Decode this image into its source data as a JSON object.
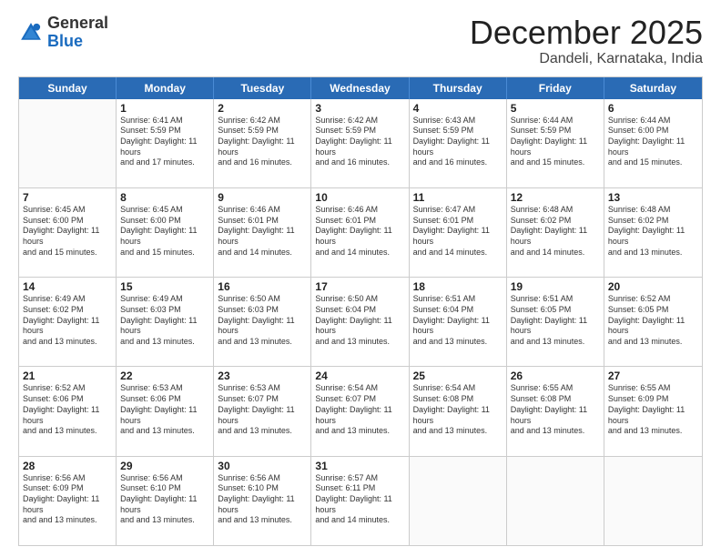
{
  "logo": {
    "general": "General",
    "blue": "Blue"
  },
  "header": {
    "month": "December 2025",
    "location": "Dandeli, Karnataka, India"
  },
  "weekdays": [
    "Sunday",
    "Monday",
    "Tuesday",
    "Wednesday",
    "Thursday",
    "Friday",
    "Saturday"
  ],
  "weeks": [
    [
      {
        "day": "",
        "sunrise": "",
        "sunset": "",
        "daylight": "",
        "empty": true
      },
      {
        "day": "1",
        "sunrise": "Sunrise: 6:41 AM",
        "sunset": "Sunset: 5:59 PM",
        "daylight": "Daylight: 11 hours and 17 minutes."
      },
      {
        "day": "2",
        "sunrise": "Sunrise: 6:42 AM",
        "sunset": "Sunset: 5:59 PM",
        "daylight": "Daylight: 11 hours and 16 minutes."
      },
      {
        "day": "3",
        "sunrise": "Sunrise: 6:42 AM",
        "sunset": "Sunset: 5:59 PM",
        "daylight": "Daylight: 11 hours and 16 minutes."
      },
      {
        "day": "4",
        "sunrise": "Sunrise: 6:43 AM",
        "sunset": "Sunset: 5:59 PM",
        "daylight": "Daylight: 11 hours and 16 minutes."
      },
      {
        "day": "5",
        "sunrise": "Sunrise: 6:44 AM",
        "sunset": "Sunset: 5:59 PM",
        "daylight": "Daylight: 11 hours and 15 minutes."
      },
      {
        "day": "6",
        "sunrise": "Sunrise: 6:44 AM",
        "sunset": "Sunset: 6:00 PM",
        "daylight": "Daylight: 11 hours and 15 minutes."
      }
    ],
    [
      {
        "day": "7",
        "sunrise": "Sunrise: 6:45 AM",
        "sunset": "Sunset: 6:00 PM",
        "daylight": "Daylight: 11 hours and 15 minutes."
      },
      {
        "day": "8",
        "sunrise": "Sunrise: 6:45 AM",
        "sunset": "Sunset: 6:00 PM",
        "daylight": "Daylight: 11 hours and 15 minutes."
      },
      {
        "day": "9",
        "sunrise": "Sunrise: 6:46 AM",
        "sunset": "Sunset: 6:01 PM",
        "daylight": "Daylight: 11 hours and 14 minutes."
      },
      {
        "day": "10",
        "sunrise": "Sunrise: 6:46 AM",
        "sunset": "Sunset: 6:01 PM",
        "daylight": "Daylight: 11 hours and 14 minutes."
      },
      {
        "day": "11",
        "sunrise": "Sunrise: 6:47 AM",
        "sunset": "Sunset: 6:01 PM",
        "daylight": "Daylight: 11 hours and 14 minutes."
      },
      {
        "day": "12",
        "sunrise": "Sunrise: 6:48 AM",
        "sunset": "Sunset: 6:02 PM",
        "daylight": "Daylight: 11 hours and 14 minutes."
      },
      {
        "day": "13",
        "sunrise": "Sunrise: 6:48 AM",
        "sunset": "Sunset: 6:02 PM",
        "daylight": "Daylight: 11 hours and 13 minutes."
      }
    ],
    [
      {
        "day": "14",
        "sunrise": "Sunrise: 6:49 AM",
        "sunset": "Sunset: 6:02 PM",
        "daylight": "Daylight: 11 hours and 13 minutes."
      },
      {
        "day": "15",
        "sunrise": "Sunrise: 6:49 AM",
        "sunset": "Sunset: 6:03 PM",
        "daylight": "Daylight: 11 hours and 13 minutes."
      },
      {
        "day": "16",
        "sunrise": "Sunrise: 6:50 AM",
        "sunset": "Sunset: 6:03 PM",
        "daylight": "Daylight: 11 hours and 13 minutes."
      },
      {
        "day": "17",
        "sunrise": "Sunrise: 6:50 AM",
        "sunset": "Sunset: 6:04 PM",
        "daylight": "Daylight: 11 hours and 13 minutes."
      },
      {
        "day": "18",
        "sunrise": "Sunrise: 6:51 AM",
        "sunset": "Sunset: 6:04 PM",
        "daylight": "Daylight: 11 hours and 13 minutes."
      },
      {
        "day": "19",
        "sunrise": "Sunrise: 6:51 AM",
        "sunset": "Sunset: 6:05 PM",
        "daylight": "Daylight: 11 hours and 13 minutes."
      },
      {
        "day": "20",
        "sunrise": "Sunrise: 6:52 AM",
        "sunset": "Sunset: 6:05 PM",
        "daylight": "Daylight: 11 hours and 13 minutes."
      }
    ],
    [
      {
        "day": "21",
        "sunrise": "Sunrise: 6:52 AM",
        "sunset": "Sunset: 6:06 PM",
        "daylight": "Daylight: 11 hours and 13 minutes."
      },
      {
        "day": "22",
        "sunrise": "Sunrise: 6:53 AM",
        "sunset": "Sunset: 6:06 PM",
        "daylight": "Daylight: 11 hours and 13 minutes."
      },
      {
        "day": "23",
        "sunrise": "Sunrise: 6:53 AM",
        "sunset": "Sunset: 6:07 PM",
        "daylight": "Daylight: 11 hours and 13 minutes."
      },
      {
        "day": "24",
        "sunrise": "Sunrise: 6:54 AM",
        "sunset": "Sunset: 6:07 PM",
        "daylight": "Daylight: 11 hours and 13 minutes."
      },
      {
        "day": "25",
        "sunrise": "Sunrise: 6:54 AM",
        "sunset": "Sunset: 6:08 PM",
        "daylight": "Daylight: 11 hours and 13 minutes."
      },
      {
        "day": "26",
        "sunrise": "Sunrise: 6:55 AM",
        "sunset": "Sunset: 6:08 PM",
        "daylight": "Daylight: 11 hours and 13 minutes."
      },
      {
        "day": "27",
        "sunrise": "Sunrise: 6:55 AM",
        "sunset": "Sunset: 6:09 PM",
        "daylight": "Daylight: 11 hours and 13 minutes."
      }
    ],
    [
      {
        "day": "28",
        "sunrise": "Sunrise: 6:56 AM",
        "sunset": "Sunset: 6:09 PM",
        "daylight": "Daylight: 11 hours and 13 minutes."
      },
      {
        "day": "29",
        "sunrise": "Sunrise: 6:56 AM",
        "sunset": "Sunset: 6:10 PM",
        "daylight": "Daylight: 11 hours and 13 minutes."
      },
      {
        "day": "30",
        "sunrise": "Sunrise: 6:56 AM",
        "sunset": "Sunset: 6:10 PM",
        "daylight": "Daylight: 11 hours and 13 minutes."
      },
      {
        "day": "31",
        "sunrise": "Sunrise: 6:57 AM",
        "sunset": "Sunset: 6:11 PM",
        "daylight": "Daylight: 11 hours and 14 minutes."
      },
      {
        "day": "",
        "sunrise": "",
        "sunset": "",
        "daylight": "",
        "empty": true
      },
      {
        "day": "",
        "sunrise": "",
        "sunset": "",
        "daylight": "",
        "empty": true
      },
      {
        "day": "",
        "sunrise": "",
        "sunset": "",
        "daylight": "",
        "empty": true
      }
    ]
  ]
}
